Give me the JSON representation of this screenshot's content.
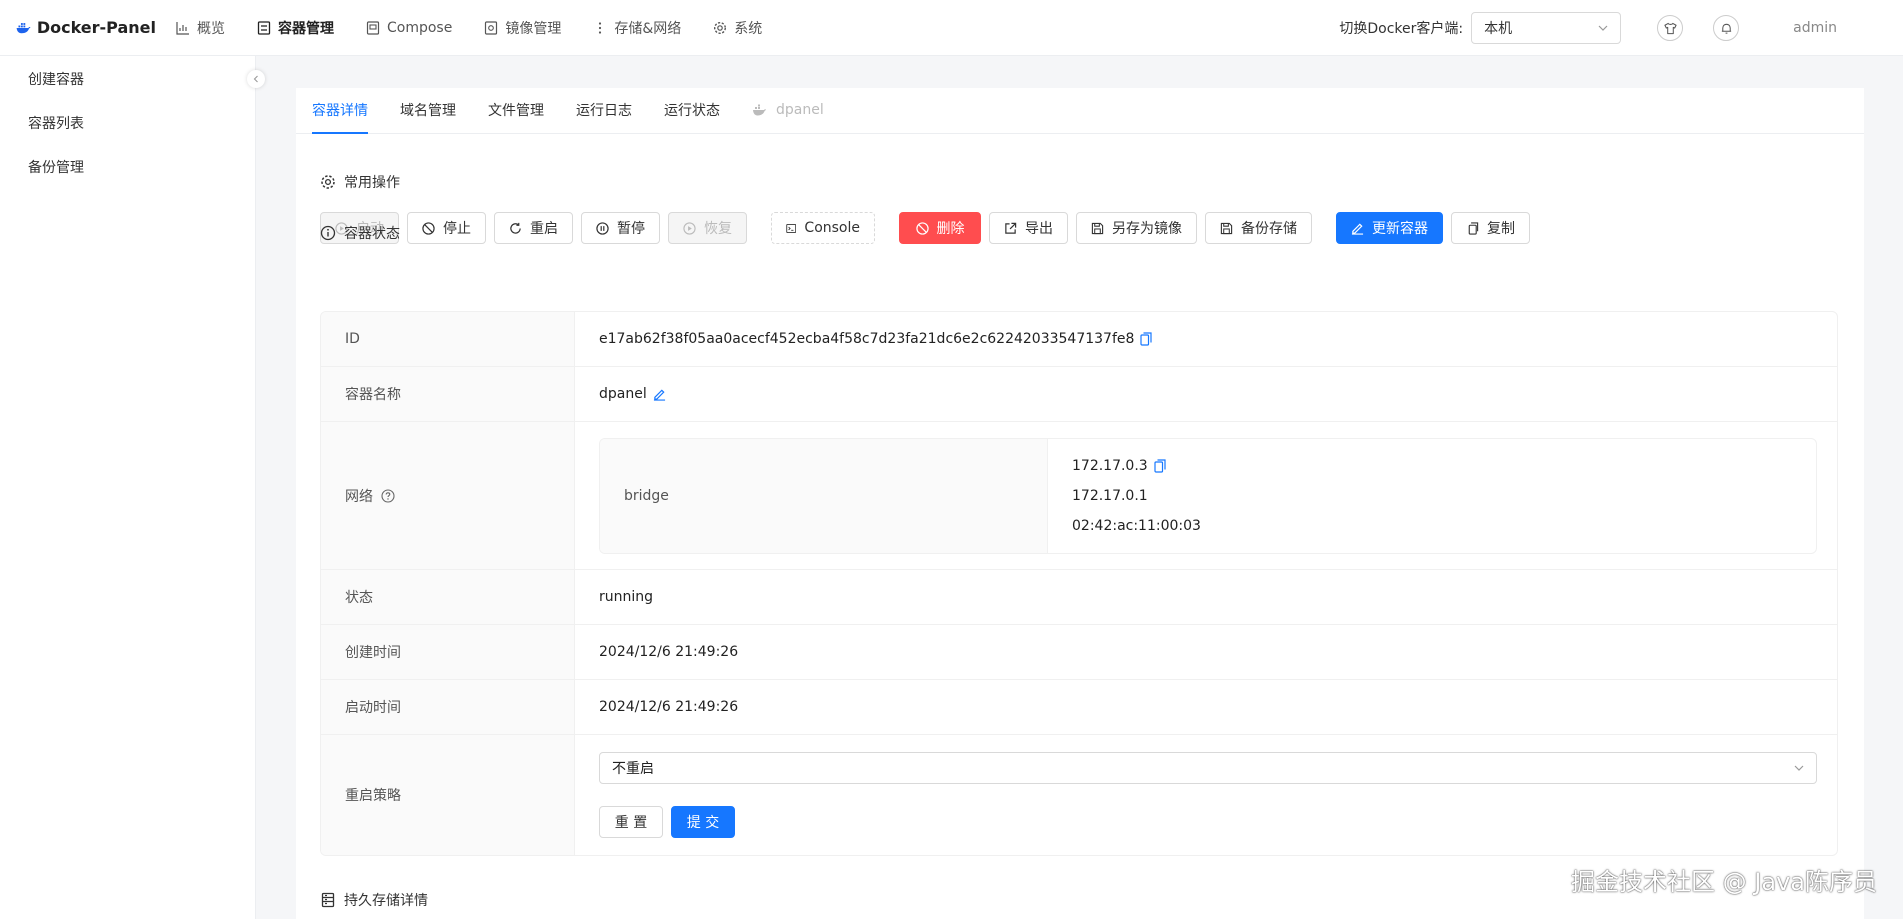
{
  "brand": {
    "title": "Docker-Panel",
    "color": "#1d63ed"
  },
  "topnav": [
    {
      "label": "概览",
      "icon": "chart-icon"
    },
    {
      "label": "容器管理",
      "icon": "container-icon",
      "active": true
    },
    {
      "label": "Compose",
      "icon": "compose-icon"
    },
    {
      "label": "镜像管理",
      "icon": "image-icon"
    },
    {
      "label": "存储&网络",
      "icon": "more-vertical-icon"
    },
    {
      "label": "系统",
      "icon": "gear-icon"
    }
  ],
  "header": {
    "switch_label": "切换Docker客户端:",
    "client_value": "本机",
    "user": "admin"
  },
  "sidebar": {
    "items": [
      {
        "label": "创建容器"
      },
      {
        "label": "容器列表"
      },
      {
        "label": "备份管理"
      }
    ]
  },
  "tabs": [
    {
      "label": "容器详情",
      "active": true
    },
    {
      "label": "域名管理"
    },
    {
      "label": "文件管理"
    },
    {
      "label": "运行日志"
    },
    {
      "label": "运行状态"
    },
    {
      "label": "dpanel",
      "disabled": true
    }
  ],
  "sections": {
    "ops_title": "常用操作",
    "status_title": "容器状态",
    "storage_title": "持久存储详情"
  },
  "ops": {
    "start": "启动",
    "stop": "停止",
    "restart": "重启",
    "pause": "暂停",
    "resume": "恢复",
    "console": "Console",
    "delete": "删除",
    "export": "导出",
    "save_image": "另存为镜像",
    "backup": "备份存储",
    "update": "更新容器",
    "copy": "复制"
  },
  "details": {
    "id_label": "ID",
    "id_value": "e17ab62f38f05aa0acecf452ecba4f58c7d23fa21dc6e2c62242033547137fe8",
    "name_label": "容器名称",
    "name_value": "dpanel",
    "network_label": "网络",
    "network_name": "bridge",
    "network_ip": "172.17.0.3",
    "network_gateway": "172.17.0.1",
    "network_mac": "02:42:ac:11:00:03",
    "state_label": "状态",
    "state_value": "running",
    "created_label": "创建时间",
    "created_value": "2024/12/6 21:49:26",
    "started_label": "启动时间",
    "started_value": "2024/12/6 21:49:26",
    "restart_label": "重启策略",
    "restart_value": "不重启",
    "reset_btn": "重 置",
    "submit_btn": "提 交"
  },
  "watermark": "掘金技术社区 @ Java陈序员",
  "colors": {
    "primary": "#1677ff",
    "danger": "#ff4d4f"
  }
}
